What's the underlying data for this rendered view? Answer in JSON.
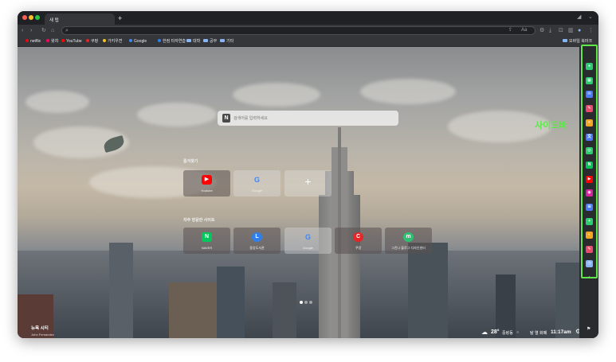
{
  "tabbar": {
    "tab_title": "새 탭",
    "new_tab_label": "+"
  },
  "bookmarks": [
    {
      "label": "netflix",
      "color": "#e50914",
      "kind": "dot"
    },
    {
      "label": "왓챠",
      "color": "#ff0558",
      "kind": "dot"
    },
    {
      "label": "YouTube",
      "color": "#ff0000",
      "kind": "dot"
    },
    {
      "label": "쿠팡",
      "color": "#e52528",
      "kind": "dot"
    },
    {
      "label": "가키우젼",
      "color": "#f5c518",
      "kind": "dot"
    },
    {
      "label": "Google",
      "color": "#4285f4",
      "kind": "dot"
    },
    {
      "label": "한컴 타자연습",
      "color": "#2f80ed",
      "kind": "dot"
    },
    {
      "label": "대학",
      "color": "#8ab4f8",
      "kind": "folder"
    },
    {
      "label": "공부",
      "color": "#8ab4f8",
      "kind": "folder"
    },
    {
      "label": "기타",
      "color": "#8ab4f8",
      "kind": "folder"
    }
  ],
  "bookmarks_right": "모바일 북마크",
  "search": {
    "logo_letter": "N",
    "placeholder": "검색어를 입력하세요"
  },
  "favorites": {
    "title": "즐겨찾기",
    "tiles": [
      {
        "label": "Youtube",
        "icon": "▶",
        "color": "#ff0000"
      },
      {
        "label": "Google",
        "icon": "G",
        "color": "#ffffff"
      },
      {
        "label": "",
        "icon": "+",
        "color": "transparent"
      }
    ]
  },
  "frequent": {
    "title": "자주 방문한 사이트",
    "tiles": [
      {
        "label": "NAVER",
        "icon": "N",
        "color": "#03c75a"
      },
      {
        "label": "중앙도서관",
        "icon": "L",
        "color": "#2f80ed"
      },
      {
        "label": "Google",
        "icon": "G",
        "color": "#ffffff"
      },
      {
        "label": "쿠팡",
        "icon": "C",
        "color": "#e52528"
      },
      {
        "label": "그린나 블로그 디자인센터",
        "icon": "m",
        "color": "#2fbf71"
      }
    ]
  },
  "bottom_left": {
    "city": "뉴욕 시티",
    "credit": "John Fernandez"
  },
  "bottom_right": {
    "weather_temp": "28°",
    "weather_place": "중랑동",
    "weather_icon": "cloud-icon",
    "edit_label": "탐 열 화폐",
    "time": "11:17am"
  },
  "sidebar": {
    "annotation_label": "사이드바",
    "annotation_color": "#5ee84a",
    "icons": [
      {
        "name": "whale-icon",
        "glyph": "●",
        "color": "#2ecc71"
      },
      {
        "name": "calendar-icon",
        "glyph": "▦",
        "color": "#2ecc71"
      },
      {
        "name": "mail-icon",
        "glyph": "✉",
        "color": "#4a7bf7"
      },
      {
        "name": "memo-icon",
        "glyph": "✎",
        "color": "#e94b6b"
      },
      {
        "name": "note-icon",
        "glyph": "≡",
        "color": "#f5a623"
      },
      {
        "name": "translate-icon",
        "glyph": "文",
        "color": "#4a7bf7"
      },
      {
        "name": "chat-icon",
        "glyph": "◎",
        "color": "#2ecc71"
      },
      {
        "name": "naver-icon",
        "glyph": "N",
        "color": "#03c75a"
      },
      {
        "name": "youtube-icon",
        "glyph": "▶",
        "color": "#ff0000"
      },
      {
        "name": "instagram-icon",
        "glyph": "◉",
        "color": "#d6249f"
      },
      {
        "name": "grid-icon",
        "glyph": "⊞",
        "color": "#4a7bf7"
      },
      {
        "name": "plus-circle-icon",
        "glyph": "+",
        "color": "#2ecc71"
      },
      {
        "name": "palette-icon",
        "glyph": "◐",
        "color": "#f5a623"
      },
      {
        "name": "pen-icon",
        "glyph": "✎",
        "color": "#e94b6b"
      },
      {
        "name": "clock-icon",
        "glyph": "◷",
        "color": "#8ab4f8"
      },
      {
        "name": "more-icon",
        "glyph": "•",
        "color": "#9aa0a6"
      }
    ]
  }
}
